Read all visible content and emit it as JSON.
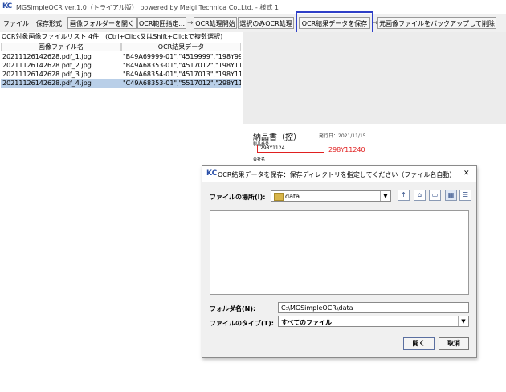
{
  "window": {
    "logo": "KC",
    "title": "MGSimpleOCR ver.1.0（トライアル版） powered by Meigi Technica Co.,Ltd. - 様式 1"
  },
  "menu": {
    "file": "ファイル",
    "format": "保存形式"
  },
  "toolbar": {
    "open_folder": "画像フォルダーを開く",
    "ocr_range": "OCR範囲指定...",
    "arrow": "→",
    "ocr_start": "OCR処理開始",
    "ocr_selected": "選択のみOCR処理",
    "save_ocr": "OCR結果データを保存",
    "backup_delete": "元画像ファイルをバックアップして削除"
  },
  "list": {
    "label": "OCR対象画像ファイルリスト 4件　(Ctrl+Click又はShift+Clickで複数選択)",
    "columns": [
      "画像ファイル名",
      "OCR結果データ"
    ],
    "rows": [
      [
        "20211126142628.pdf_1.jpg",
        "\"B49A69999-01\",\"4519999\",\"198Y999..."
      ],
      [
        "20211126142628.pdf_2.jpg",
        "\"B49A68353-01\",\"4517012\",\"198Y112..."
      ],
      [
        "20211126142628.pdf_3.jpg",
        "\"B49A68354-01\",\"4517013\",\"198Y112..."
      ],
      [
        "20211126142628.pdf_4.jpg",
        "\"C49A68353-01\",\"5517012\",\"298Y112..."
      ]
    ]
  },
  "preview": {
    "heading": "納品書（控）",
    "date": "発行日：2021/11/15",
    "field_label": "製品番号",
    "field_value": "298Y1124",
    "ocr_text": "298Y11240",
    "footer": "会社名"
  },
  "dialog": {
    "title": "OCR結果データを保存：保存ディレクトリを指定してください（ファイル名自動）",
    "location_label": "ファイルの場所(I):",
    "location_value": "data",
    "folder_label": "フォルダ名(N):",
    "folder_value": "C:\\MGSimpleOCR\\data",
    "type_label": "ファイルのタイプ(T):",
    "type_value": "すべてのファイル",
    "open_button": "開く",
    "cancel_button": "取消",
    "close_glyph": "✕"
  },
  "colors": {
    "highlight": "#2e3fc7",
    "selected_row": "#b9cfe8",
    "ocr_red": "#e02020"
  }
}
